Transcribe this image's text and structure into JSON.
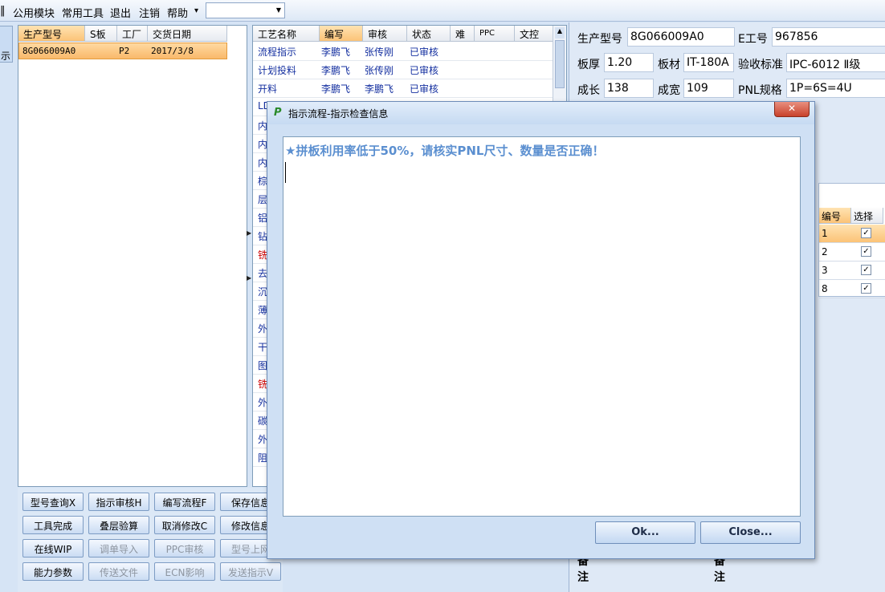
{
  "menu": {
    "first_char": "‖",
    "items": [
      "公用模块",
      "常用工具",
      "退出",
      "注销",
      "帮助"
    ],
    "help_arrow": "▾"
  },
  "left_stub": {
    "label": "示"
  },
  "left_grid": {
    "headers": [
      "生产型号",
      "S板",
      "工厂",
      "交货日期"
    ],
    "rows": [
      {
        "model": "8G066009A0",
        "sboard": "",
        "factory": "P2",
        "date": "2017/3/8"
      }
    ]
  },
  "process_grid": {
    "headers": [
      "工艺名称",
      "编写",
      "审核",
      "状态",
      "难",
      "PPC",
      "文控"
    ],
    "rows": [
      {
        "name": "流程指示",
        "writer": "李鹏飞",
        "reviewer": "张传刚",
        "status": "已审核"
      },
      {
        "name": "计划投料",
        "writer": "李鹏飞",
        "reviewer": "张传刚",
        "status": "已审核"
      },
      {
        "name": "开料",
        "writer": "李鹏飞",
        "reviewer": "李鹏飞",
        "status": "已审核"
      }
    ],
    "truncated": [
      "开",
      "LD",
      "内",
      "内",
      "内",
      "棕",
      "层",
      "铝",
      "钻",
      "铣",
      "去",
      "沉",
      "薄",
      "外",
      "干",
      "图",
      "铣",
      "外",
      "碳",
      "外",
      "阻"
    ],
    "red_index": [
      9,
      16
    ]
  },
  "buttons": [
    {
      "label": "型号查询X",
      "enabled": true
    },
    {
      "label": "指示审核H",
      "enabled": true
    },
    {
      "label": "编写流程F",
      "enabled": true
    },
    {
      "label": "保存信息",
      "enabled": true
    },
    {
      "label": "工具完成",
      "enabled": true
    },
    {
      "label": "叠层验算",
      "enabled": true
    },
    {
      "label": "取消修改C",
      "enabled": true
    },
    {
      "label": "修改信息",
      "enabled": true
    },
    {
      "label": "在线WIP",
      "enabled": true
    },
    {
      "label": "调单导入",
      "enabled": false
    },
    {
      "label": "PPC审核",
      "enabled": false
    },
    {
      "label": "型号上网",
      "enabled": false
    },
    {
      "label": "能力参数",
      "enabled": true
    },
    {
      "label": "传送文件",
      "enabled": false
    },
    {
      "label": "ECN影响",
      "enabled": false
    },
    {
      "label": "发送指示V",
      "enabled": false
    }
  ],
  "info": {
    "model_label": "生产型号",
    "model_value": "8G066009A0",
    "eno_label": "E工号",
    "eno_value": "967856",
    "thickness_label": "板厚",
    "thickness_value": "1.20",
    "material_label": "板材",
    "material_value": "IT-180A",
    "standard_label": "验收标准",
    "standard_value": "IPC-6012 Ⅱ级",
    "length_label": "成长",
    "length_value": "138",
    "width_label": "成宽",
    "width_value": "109",
    "pnl_label": "PNL规格",
    "pnl_value": "1P=6S=4U"
  },
  "right_grid": {
    "headers": [
      "编号",
      "选择"
    ],
    "rows": [
      "1",
      "2",
      "3",
      "8"
    ]
  },
  "remark_label": "备注",
  "dialog": {
    "title": "指示流程-指示检查信息",
    "icon": "P",
    "close": "✕",
    "message": "★拼板利用率低于50%，请核实PNL尺寸、数量是否正确！",
    "ok_label": "Ok...",
    "close_label": "Close..."
  }
}
